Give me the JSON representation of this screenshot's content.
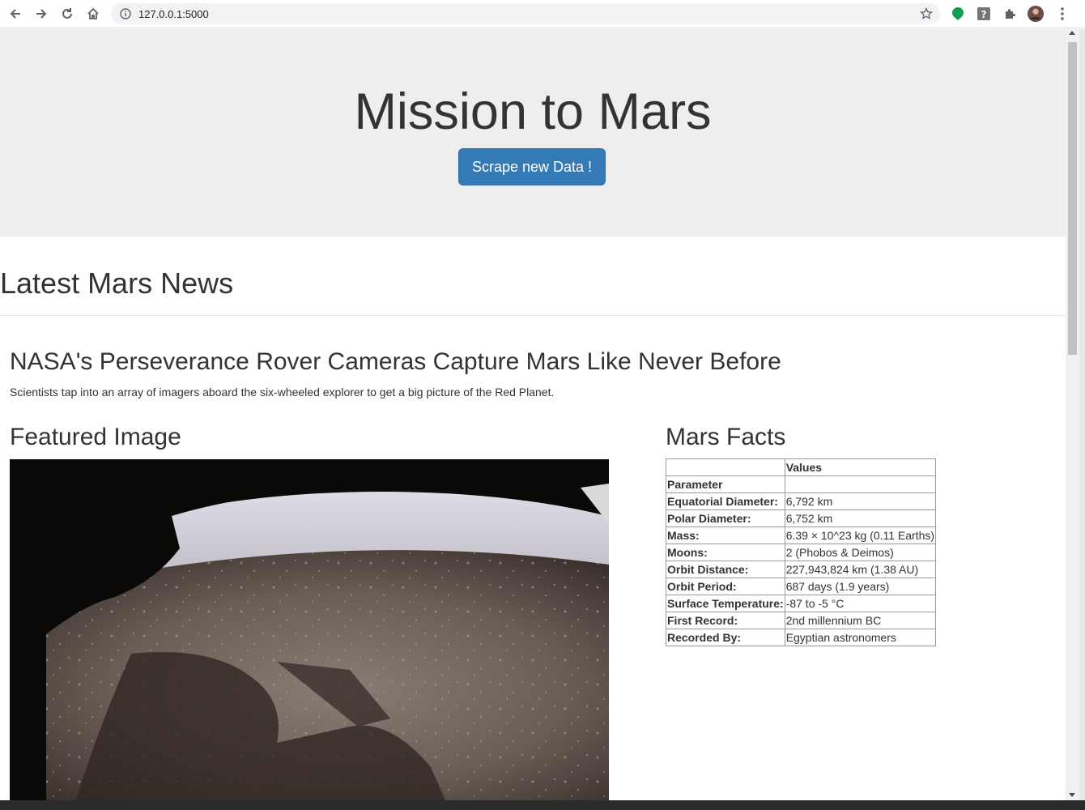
{
  "browser": {
    "url": "127.0.0.1:5000",
    "icons": [
      "back-icon",
      "forward-icon",
      "reload-icon",
      "home-icon",
      "info-icon",
      "star-icon",
      "extension-green-icon",
      "extension-help-icon",
      "extensions-puzzle-icon",
      "profile-avatar",
      "menu-dots-icon"
    ]
  },
  "hero": {
    "title": "Mission to Mars",
    "button_label": "Scrape new Data !"
  },
  "news": {
    "heading": "Latest Mars News",
    "title": "NASA's Perseverance Rover Cameras Capture Mars Like Never Before",
    "paragraph": "Scientists tap into an array of imagers aboard the six-wheeled explorer to get a big picture of the Red Planet."
  },
  "featured": {
    "heading": "Featured Image"
  },
  "facts": {
    "heading": "Mars Facts",
    "header": [
      "",
      "Values"
    ],
    "index_label": "Parameter",
    "rows": [
      [
        "Equatorial Diameter:",
        "6,792 km"
      ],
      [
        "Polar Diameter:",
        "6,752 km"
      ],
      [
        "Mass:",
        "6.39 × 10^23 kg (0.11 Earths)"
      ],
      [
        "Moons:",
        "2 (Phobos & Deimos)"
      ],
      [
        "Orbit Distance:",
        "227,943,824 km (1.38 AU)"
      ],
      [
        "Orbit Period:",
        "687 days (1.9 years)"
      ],
      [
        "Surface Temperature:",
        "-87 to -5 °C"
      ],
      [
        "First Record:",
        "2nd millennium BC"
      ],
      [
        "Recorded By:",
        "Egyptian astronomers"
      ]
    ]
  },
  "colors": {
    "jumbotron_bg": "#eeeeee",
    "button_bg": "#337ab7"
  }
}
